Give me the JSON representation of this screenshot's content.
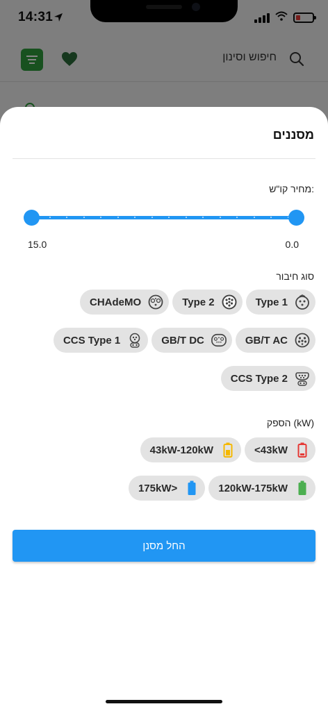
{
  "status": {
    "time": "14:31"
  },
  "app_header": {
    "search_label": "חיפוש וסינון"
  },
  "sheet": {
    "title": "מסננים",
    "price": {
      "label": "מחיר קו\"ש:",
      "min_value": "0.0",
      "max_value": "15.0",
      "selected_min": 0.0,
      "selected_max": 15.0
    },
    "connector": {
      "label": "סוג חיבור",
      "rows": [
        [
          {
            "label": "Type 1",
            "icon": "type1-plug-icon"
          },
          {
            "label": "Type 2",
            "icon": "type2-plug-icon"
          },
          {
            "label": "CHAdeMO",
            "icon": "chademo-plug-icon"
          }
        ],
        [
          {
            "label": "GB/T AC",
            "icon": "gbt-ac-plug-icon"
          },
          {
            "label": "GB/T DC",
            "icon": "gbt-dc-plug-icon"
          },
          {
            "label": "CCS Type 1",
            "icon": "ccs1-plug-icon"
          }
        ],
        [
          {
            "label": "CCS Type 2",
            "icon": "ccs2-plug-icon"
          }
        ]
      ]
    },
    "power": {
      "label": "הספק (kW)",
      "rows": [
        [
          {
            "label": "<43kW",
            "icon": "battery-low-icon",
            "color": "#e53935"
          },
          {
            "label": "43kW-120kW",
            "icon": "battery-medium-icon",
            "color": "#f5b800"
          }
        ],
        [
          {
            "label": "120kW-175kW",
            "icon": "battery-high-icon",
            "color": "#4caf50"
          },
          {
            "label": "175kW>",
            "icon": "battery-full-icon",
            "color": "#2196f3"
          }
        ]
      ]
    },
    "apply_label": "החל מסנן"
  },
  "colors": {
    "accent": "#2196f3",
    "brand_green": "#2e9b3d"
  }
}
